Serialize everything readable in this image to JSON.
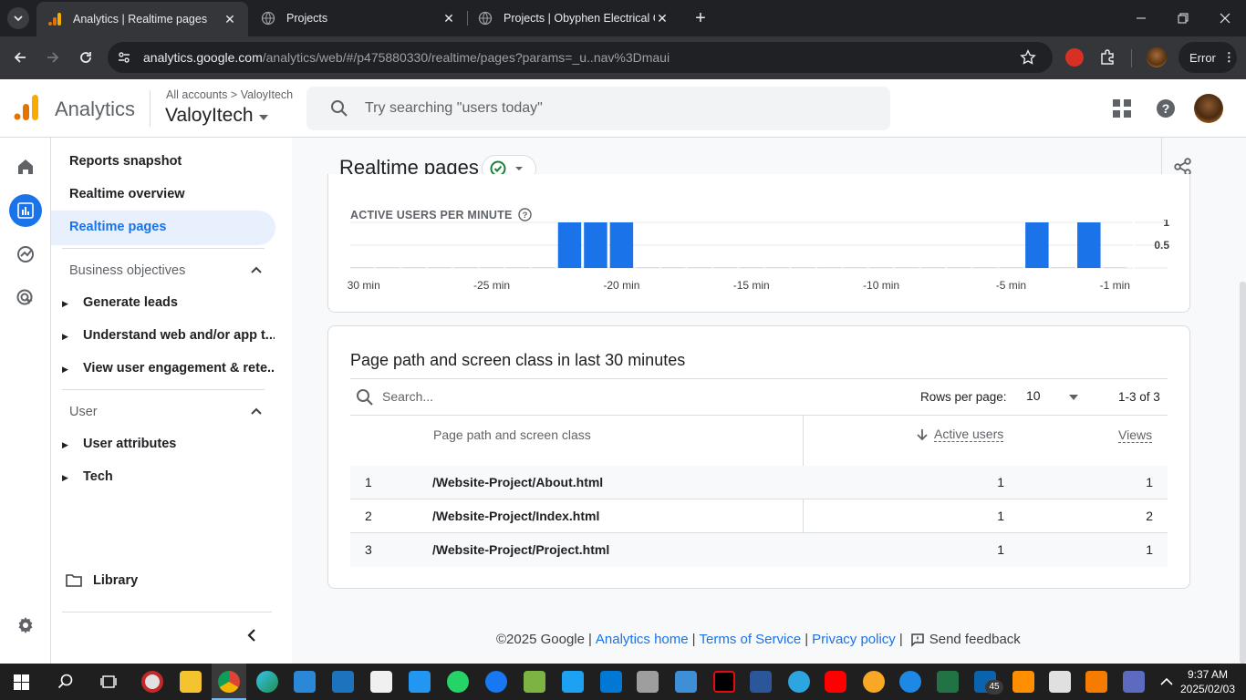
{
  "browser": {
    "tabs": [
      {
        "title": "Analytics | Realtime pages",
        "active": true
      },
      {
        "title": "Projects",
        "active": false
      },
      {
        "title": "Projects | Obyphen Electrical Co",
        "active": false
      }
    ],
    "url_domain": "analytics.google.com",
    "url_path": "/analytics/web/#/p475880330/realtime/pages?params=_u..nav%3Dmaui",
    "error_label": "Error"
  },
  "header": {
    "app_name": "Analytics",
    "breadcrumb_all": "All accounts",
    "breadcrumb_sep": ">",
    "breadcrumb_account": "ValoyItech",
    "property_name": "ValoyItech",
    "search_placeholder": "Try searching \"users today\""
  },
  "nav": {
    "reports_snapshot": "Reports snapshot",
    "realtime_overview": "Realtime overview",
    "realtime_pages": "Realtime pages",
    "business_objectives": "Business objectives",
    "bo_items": [
      "Generate leads",
      "Understand web and/or app t...",
      "View user engagement & rete..."
    ],
    "user_section": "User",
    "user_items": [
      "User attributes",
      "Tech"
    ],
    "library": "Library"
  },
  "page": {
    "title": "Realtime pages"
  },
  "chart": {
    "label": "ACTIVE USERS PER MINUTE",
    "help_icon": "?"
  },
  "chart_data": {
    "type": "bar",
    "title": "ACTIVE USERS PER MINUTE",
    "categories": [
      "-30",
      "-29",
      "-28",
      "-27",
      "-26",
      "-25",
      "-24",
      "-23",
      "-22",
      "-21",
      "-20",
      "-19",
      "-18",
      "-17",
      "-16",
      "-15",
      "-14",
      "-13",
      "-12",
      "-11",
      "-10",
      "-9",
      "-8",
      "-7",
      "-6",
      "-5",
      "-4",
      "-3",
      "-2",
      "-1"
    ],
    "values": [
      0,
      0,
      0,
      0,
      0,
      0,
      0,
      0,
      1,
      1,
      1,
      0,
      0,
      0,
      0,
      0,
      0,
      0,
      0,
      0,
      0,
      0,
      0,
      0,
      0,
      0,
      1,
      0,
      1,
      0
    ],
    "x_tick_labels": [
      "-30 min",
      "-25 min",
      "-20 min",
      "-15 min",
      "-10 min",
      "-5 min",
      "-1 min"
    ],
    "y_tick_labels": [
      "1",
      "0.5"
    ],
    "ylim": [
      0,
      1
    ],
    "bar_color": "#1a73e8"
  },
  "table": {
    "title": "Page path and screen class in last 30 minutes",
    "search_placeholder": "Search...",
    "rows_per_page_label": "Rows per page:",
    "rows_per_page_value": "10",
    "pagination": "1-3 of 3",
    "col_path": "Page path and screen class",
    "col_active": "Active users",
    "col_views": "Views",
    "rows": [
      {
        "n": "1",
        "path": "/Website-Project/About.html",
        "active": "1",
        "views": "1"
      },
      {
        "n": "2",
        "path": "/Website-Project/Index.html",
        "active": "1",
        "views": "2"
      },
      {
        "n": "3",
        "path": "/Website-Project/Project.html",
        "active": "1",
        "views": "1"
      }
    ]
  },
  "footer": {
    "copyright": "©2025 Google",
    "analytics_home": "Analytics home",
    "terms": "Terms of Service",
    "privacy": "Privacy policy",
    "feedback": "Send feedback"
  },
  "taskbar": {
    "time": "9:37 AM",
    "date": "2025/02/03",
    "mail_badge": "45"
  },
  "colors": {
    "accent": "#1a73e8",
    "nav_active_bg": "#e8f0fe",
    "analytics_orange": "#f9ab00",
    "analytics_dark_orange": "#e37400"
  }
}
